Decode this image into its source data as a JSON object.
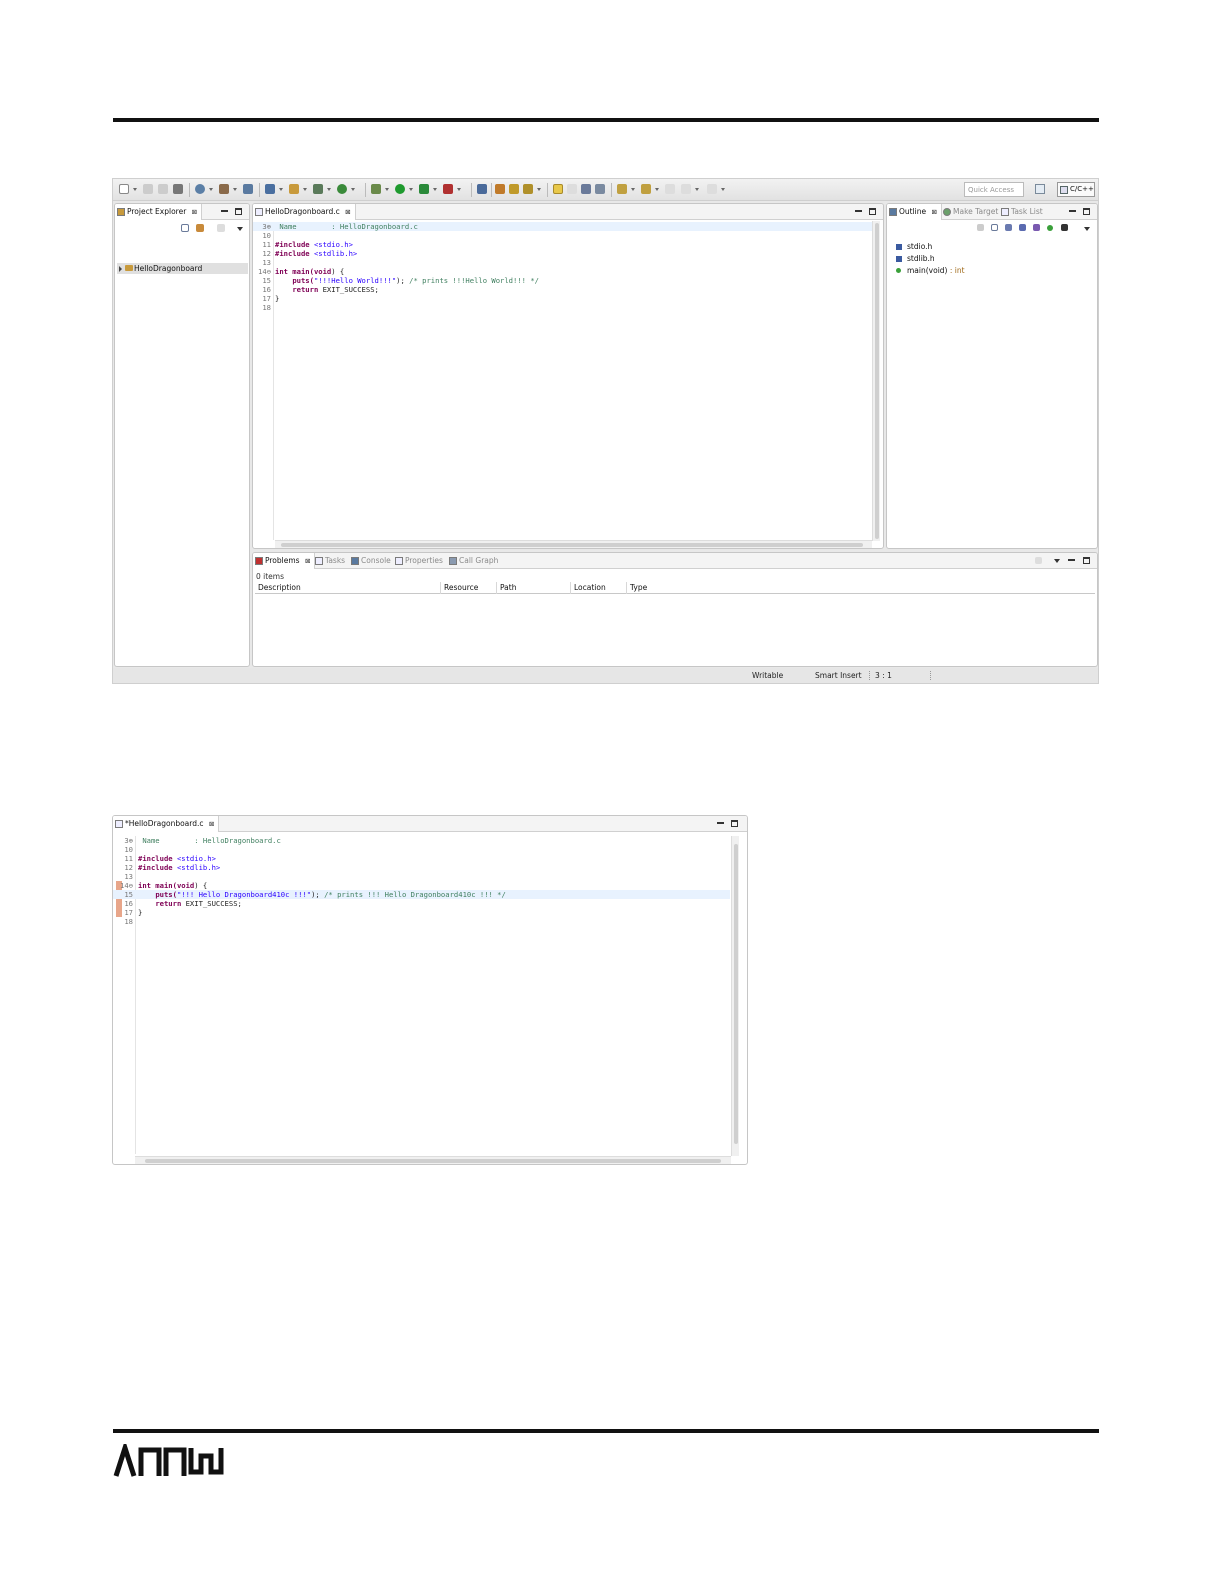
{
  "ide": {
    "toolbar": {
      "quick_access_placeholder": "Quick Access",
      "perspective_label": "C/C++"
    },
    "project_explorer": {
      "tab_label": "Project Explorer",
      "close_glyph": "⊠",
      "tree": [
        {
          "label": "HelloDragonboard",
          "expanded": false
        }
      ]
    },
    "editor": {
      "tab_label": "HelloDragonboard.c",
      "close_glyph": "⊠",
      "lines": [
        {
          "num": "3⊕",
          "text": " Name        : HelloDragonboard.c"
        },
        {
          "num": "10",
          "text": ""
        },
        {
          "num": "11",
          "pre": "#include ",
          "inc": "<stdio.h>"
        },
        {
          "num": "12",
          "pre": "#include ",
          "inc": "<stdlib.h>"
        },
        {
          "num": "13",
          "text": ""
        },
        {
          "num": "14⊖",
          "kw1": "int",
          "mid": " main(",
          "kw2": "void",
          "post": ") {"
        },
        {
          "num": "15",
          "indent": "    ",
          "call": "puts(",
          "str": "\"!!!Hello World!!!\"",
          "after": "); ",
          "cmt": "/* prints !!!Hello World!!! */"
        },
        {
          "num": "16",
          "indent": "    ",
          "kw": "return",
          "rest": " EXIT_SUCCESS;"
        },
        {
          "num": "17",
          "text": "}"
        },
        {
          "num": "18",
          "text": ""
        }
      ]
    },
    "outline": {
      "tabs": [
        "Outline",
        "Make Target",
        "Task List"
      ],
      "close_glyph": "⊠",
      "items": [
        {
          "label": "stdio.h",
          "suffix": "",
          "icon": "include-icon"
        },
        {
          "label": "stdlib.h",
          "suffix": "",
          "icon": "include-icon"
        },
        {
          "label": "main(void)",
          "suffix": " : int",
          "icon": "function-icon"
        }
      ]
    },
    "problems": {
      "tabs": [
        "Problems",
        "Tasks",
        "Console",
        "Properties",
        "Call Graph"
      ],
      "close_glyph": "⊠",
      "count": "0 items",
      "columns": [
        "Description",
        "Resource",
        "Path",
        "Location",
        "Type"
      ]
    },
    "status": {
      "writable": "Writable",
      "insert_mode": "Smart Insert",
      "position": "3 : 1"
    }
  },
  "editor2": {
    "tab_label": "*HelloDragonboard.c",
    "close_glyph": "⊠",
    "lines": [
      {
        "num": "3⊕",
        "text": " Name        : HelloDragonboard.c"
      },
      {
        "num": "10",
        "text": ""
      },
      {
        "num": "11",
        "pre": "#include ",
        "inc": "<stdio.h>"
      },
      {
        "num": "12",
        "pre": "#include ",
        "inc": "<stdlib.h>"
      },
      {
        "num": "13",
        "text": ""
      },
      {
        "num": "14⊖",
        "kw1": "int",
        "mid": " main(",
        "kw2": "void",
        "post": ") {"
      },
      {
        "num": "15",
        "indent": "    ",
        "call": "puts(",
        "str": "\"!!! Hello Dragonboard410c !!!\"",
        "after": "); ",
        "cmt": "/* prints !!! Hello Dragonboard410c !!! */"
      },
      {
        "num": "16",
        "indent": "    ",
        "kw": "return",
        "rest": " EXIT_SUCCESS;"
      },
      {
        "num": "17",
        "text": "}"
      },
      {
        "num": "18",
        "text": ""
      }
    ]
  },
  "colors": {
    "keyword": "#7f0055",
    "string": "#2a00ff",
    "comment": "#3f7f5f",
    "current_line": "#e8f2fe",
    "change_marker": "#e8a68a"
  }
}
